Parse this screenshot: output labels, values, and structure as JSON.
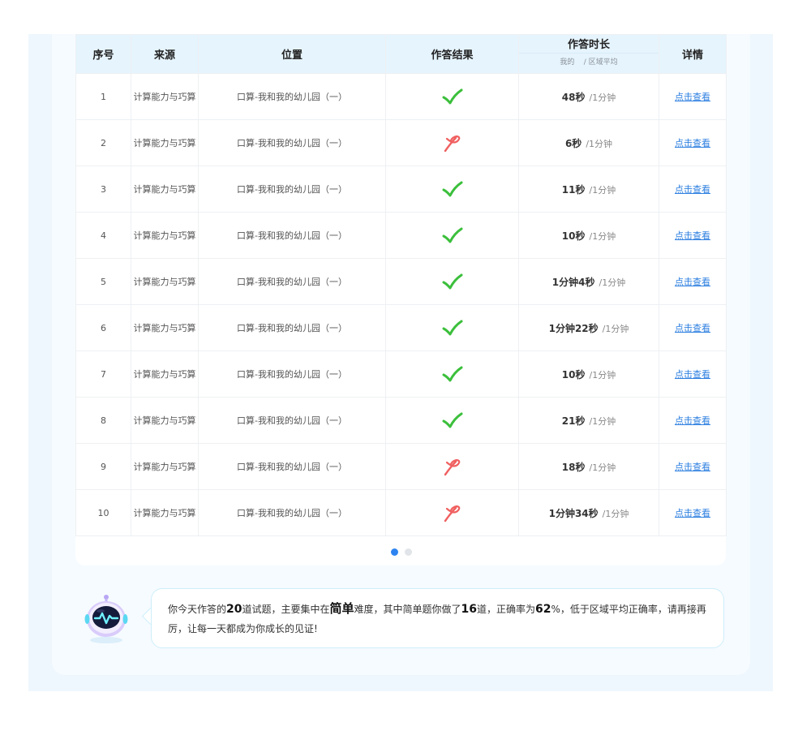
{
  "table": {
    "headers": {
      "index": "序号",
      "source": "来源",
      "location": "位置",
      "result": "作答结果",
      "duration": "作答时长",
      "duration_mine": "我的",
      "duration_avg": "/ 区域平均",
      "detail": "详情"
    },
    "rows": [
      {
        "index": "1",
        "source": "计算能力与巧算",
        "location": "口算-我和我的幼儿园（一）",
        "result": "correct",
        "mine": "48秒",
        "avg": "/1分钟",
        "detail": "点击查看"
      },
      {
        "index": "2",
        "source": "计算能力与巧算",
        "location": "口算-我和我的幼儿园（一）",
        "result": "wrong",
        "mine": "6秒",
        "avg": "/1分钟",
        "detail": "点击查看"
      },
      {
        "index": "3",
        "source": "计算能力与巧算",
        "location": "口算-我和我的幼儿园（一）",
        "result": "correct",
        "mine": "11秒",
        "avg": "/1分钟",
        "detail": "点击查看"
      },
      {
        "index": "4",
        "source": "计算能力与巧算",
        "location": "口算-我和我的幼儿园（一）",
        "result": "correct",
        "mine": "10秒",
        "avg": "/1分钟",
        "detail": "点击查看"
      },
      {
        "index": "5",
        "source": "计算能力与巧算",
        "location": "口算-我和我的幼儿园（一）",
        "result": "correct",
        "mine": "1分钟4秒",
        "avg": "/1分钟",
        "detail": "点击查看"
      },
      {
        "index": "6",
        "source": "计算能力与巧算",
        "location": "口算-我和我的幼儿园（一）",
        "result": "correct",
        "mine": "1分钟22秒",
        "avg": "/1分钟",
        "detail": "点击查看"
      },
      {
        "index": "7",
        "source": "计算能力与巧算",
        "location": "口算-我和我的幼儿园（一）",
        "result": "correct",
        "mine": "10秒",
        "avg": "/1分钟",
        "detail": "点击查看"
      },
      {
        "index": "8",
        "source": "计算能力与巧算",
        "location": "口算-我和我的幼儿园（一）",
        "result": "correct",
        "mine": "21秒",
        "avg": "/1分钟",
        "detail": "点击查看"
      },
      {
        "index": "9",
        "source": "计算能力与巧算",
        "location": "口算-我和我的幼儿园（一）",
        "result": "wrong",
        "mine": "18秒",
        "avg": "/1分钟",
        "detail": "点击查看"
      },
      {
        "index": "10",
        "source": "计算能力与巧算",
        "location": "口算-我和我的幼儿园（一）",
        "result": "wrong",
        "mine": "1分钟34秒",
        "avg": "/1分钟",
        "detail": "点击查看"
      }
    ]
  },
  "pagination": {
    "pages": 2,
    "active": 1
  },
  "summary": {
    "t1": "你今天作答的",
    "total": "20",
    "t2": "道试题，主要集中在",
    "level": "简单",
    "t3": "难度，其中简单题你做了",
    "easy_count": "16",
    "t4": "道，正确率为",
    "rate": "62",
    "t5": "%，低于区域平均正确率，请再接再厉，让每一天都成为你成长的见证!"
  },
  "icons": {
    "correct": "check-icon",
    "wrong": "cross-icon",
    "assistant": "robot-avatar-icon"
  },
  "colors": {
    "correct": "#3bbf3b",
    "wrong": "#f06060",
    "link": "#2d7fe0",
    "header_bg": "#e6f4fd",
    "active_dot": "#2d84f0"
  }
}
